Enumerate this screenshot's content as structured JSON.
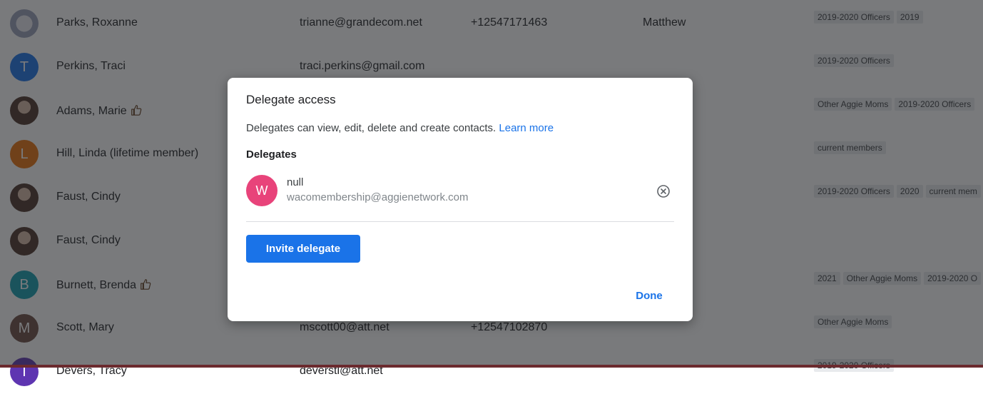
{
  "contacts": [
    {
      "avatar": "crest-photo",
      "initial": "",
      "avatar_color": "",
      "name": "Parks, Roxanne",
      "thumbs": false,
      "email": "trianne@grandecom.net",
      "phone": "+12547171463",
      "extra": "Matthew",
      "labels": [
        "2019-2020 Officers",
        "2019"
      ]
    },
    {
      "avatar": "letter",
      "initial": "T",
      "avatar_color": "#1a73e8",
      "name": "Perkins, Traci",
      "thumbs": false,
      "email": "traci.perkins@gmail.com",
      "phone": "",
      "extra": "",
      "labels": [
        "2019-2020 Officers"
      ]
    },
    {
      "avatar": "photo",
      "initial": "",
      "avatar_color": "",
      "name": "Adams, Marie",
      "thumbs": true,
      "email": "",
      "phone": "",
      "extra": "",
      "labels": [
        "Other Aggie Moms",
        "2019-2020 Officers"
      ]
    },
    {
      "avatar": "letter",
      "initial": "L",
      "avatar_color": "#e8710a",
      "name": "Hill, Linda (lifetime member)",
      "thumbs": false,
      "email": "",
      "phone": "",
      "extra": "",
      "labels": [
        "current members"
      ]
    },
    {
      "avatar": "photo",
      "initial": "",
      "avatar_color": "",
      "name": "Faust, Cindy",
      "thumbs": false,
      "email": "",
      "phone": "",
      "extra": "",
      "labels": [
        "2019-2020 Officers",
        "2020",
        "current mem"
      ]
    },
    {
      "avatar": "photo",
      "initial": "",
      "avatar_color": "",
      "name": "Faust, Cindy",
      "thumbs": false,
      "email": "",
      "phone": "",
      "extra": "",
      "labels": []
    },
    {
      "avatar": "letter",
      "initial": "B",
      "avatar_color": "#129eaf",
      "name": "Burnett, Brenda",
      "thumbs": true,
      "email": "",
      "phone": "",
      "extra": "",
      "labels": [
        "2021",
        "Other Aggie Moms",
        "2019-2020 O"
      ]
    },
    {
      "avatar": "letter",
      "initial": "M",
      "avatar_color": "#6d4c41",
      "name": "Scott, Mary",
      "thumbs": false,
      "email": "mscott00@att.net",
      "phone": "+12547102870",
      "extra": "",
      "labels": [
        "Other Aggie Moms"
      ]
    },
    {
      "avatar": "letter",
      "initial": "T",
      "avatar_color": "#5e35b1",
      "name": "Devers, Tracy",
      "thumbs": false,
      "email": "deverstl@att.net",
      "phone": "",
      "extra": "",
      "labels": [
        "2019-2020 Officers"
      ]
    }
  ],
  "dialog": {
    "title": "Delegate access",
    "description": "Delegates can view, edit, delete and create contacts.",
    "learn_more": "Learn more",
    "section_label": "Delegates",
    "delegate": {
      "initial": "W",
      "name": "null",
      "email": "wacomembership@aggienetwork.com",
      "avatar_color": "#e8437a"
    },
    "invite_label": "Invite delegate",
    "done_label": "Done"
  }
}
